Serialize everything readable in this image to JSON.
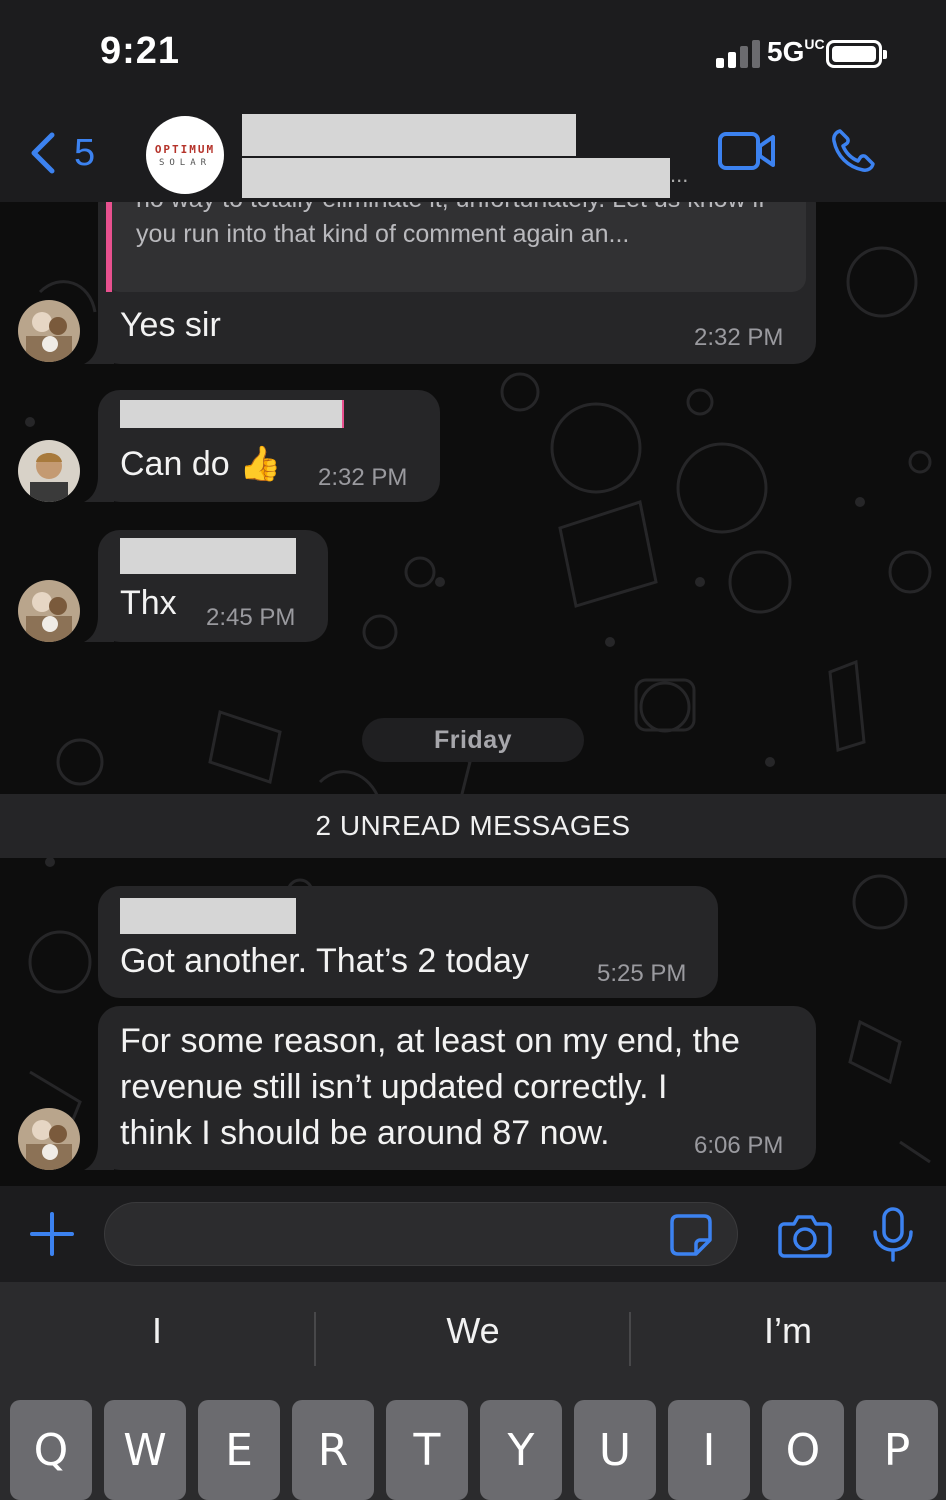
{
  "status_bar": {
    "time": "9:21",
    "network": "5G",
    "network_superscript": "UC",
    "signal_bars_filled": 2,
    "signal_bars_total": 4,
    "battery_level": 1.0
  },
  "header": {
    "back_count": "5",
    "logo_line1": "OPTIMUM",
    "logo_line2": "SOLAR",
    "ellipsis": "...",
    "icons": [
      "back-chevron-icon",
      "video-call-icon",
      "phone-icon"
    ],
    "accent_color": "#3c82f0"
  },
  "messages": [
    {
      "quoted_text": "no way to totally eliminate it, unfortunately. Let us know if you run into that kind of comment again an...",
      "text": "Yes sir",
      "time": "2:32 PM"
    },
    {
      "text": "Can do",
      "emoji": "👍",
      "time": "2:32 PM"
    },
    {
      "text": "Thx",
      "time": "2:45 PM"
    }
  ],
  "day_separator": "Friday",
  "unread_banner": "2 UNREAD MESSAGES",
  "new_messages": [
    {
      "text": "Got another. That’s 2 today",
      "time": "5:25 PM"
    },
    {
      "lines": [
        "For some reason, at least on my end, the",
        "revenue still isn’t updated correctly. I",
        "think I should be around 87 now."
      ],
      "time": "6:06 PM"
    }
  ],
  "input_bar": {
    "icons": [
      "plus-icon",
      "sticker-icon",
      "camera-icon",
      "microphone-icon"
    ]
  },
  "keyboard": {
    "suggestions": [
      "I",
      "We",
      "I’m"
    ],
    "keys": [
      "Q",
      "W",
      "E",
      "R",
      "T",
      "Y",
      "U",
      "I",
      "O",
      "P"
    ]
  },
  "colors": {
    "quote_bar": "#e8518f",
    "bubble": "#262628",
    "background": "#0d0d0d"
  }
}
